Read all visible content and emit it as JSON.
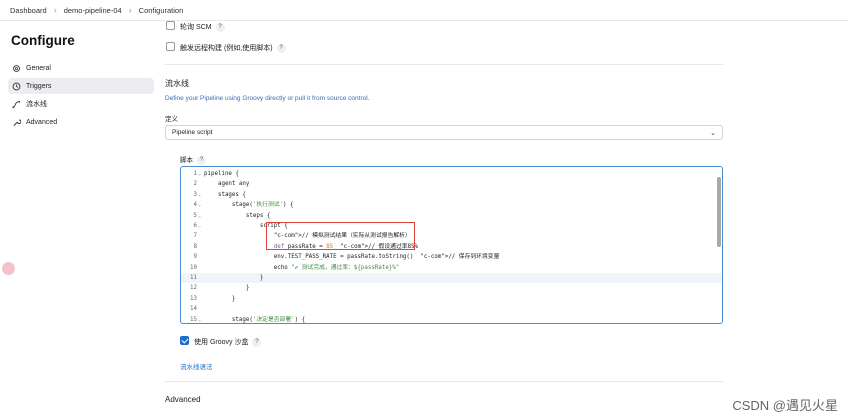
{
  "breadcrumb": [
    "Dashboard",
    "demo-pipeline-04",
    "Configuration"
  ],
  "sidebar": {
    "title": "Configure",
    "items": [
      {
        "label": "General",
        "icon": "gear-icon"
      },
      {
        "label": "Triggers",
        "icon": "clock-icon"
      },
      {
        "label": "流水线",
        "icon": "pipeline-icon"
      },
      {
        "label": "Advanced",
        "icon": "wrench-icon"
      }
    ]
  },
  "triggers": {
    "poll_scm": "轮询 SCM",
    "remote_build": "触发远程构建 (例如,使用脚本)"
  },
  "pipeline": {
    "section_title": "流水线",
    "description": "Define your Pipeline using Groovy directly or pull it from source control.",
    "definition_label": "定义",
    "definition_value": "Pipeline script",
    "script_label": "脚本",
    "sandbox_label": "使用 Groovy 沙盒",
    "syntax_link": "流水线语法"
  },
  "code_lines": [
    {
      "n": "1",
      "fold": true,
      "html": "pipeline {"
    },
    {
      "n": "2",
      "fold": false,
      "html": "    agent any"
    },
    {
      "n": "3",
      "fold": true,
      "html": "    stages {"
    },
    {
      "n": "4",
      "fold": true,
      "html": "        stage('执行测试') {"
    },
    {
      "n": "5",
      "fold": true,
      "html": "            steps {"
    },
    {
      "n": "6",
      "fold": true,
      "html": "                script {"
    },
    {
      "n": "7",
      "fold": false,
      "html": "                    // 模拟测试结果（实际从测试报告解析）"
    },
    {
      "n": "8",
      "fold": false,
      "html": "                    def passRate = 85  // 假设通过率85%"
    },
    {
      "n": "9",
      "fold": false,
      "html": "                    env.TEST_PASS_RATE = passRate.toString()  // 保存到环境变量"
    },
    {
      "n": "10",
      "fold": false,
      "html": "                    echo \"✔ 测试完成，通过率：${passRate}%\""
    },
    {
      "n": "11",
      "fold": false,
      "html": "                }"
    },
    {
      "n": "12",
      "fold": false,
      "html": "            }"
    },
    {
      "n": "13",
      "fold": false,
      "html": "        }"
    },
    {
      "n": "14",
      "fold": false,
      "html": ""
    },
    {
      "n": "15",
      "fold": true,
      "html": "        stage('决定是否部署') {"
    }
  ],
  "advanced_heading": "Advanced",
  "watermark": "CSDN @遇见火星",
  "colors": {
    "accent": "#1c6bd0",
    "redbox": "#e04040"
  }
}
